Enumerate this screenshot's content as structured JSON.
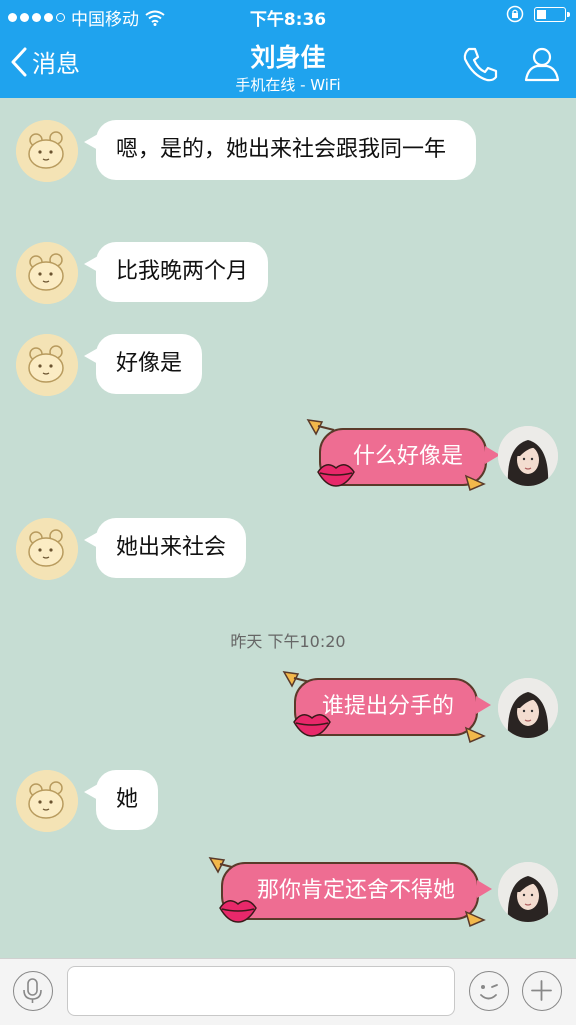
{
  "status_bar": {
    "carrier": "中国移动",
    "time": "下午8:36",
    "signal_icon": "signal-dots-icon",
    "wifi_icon": "wifi-icon",
    "lock_icon": "rotation-lock-icon",
    "battery_icon": "battery-icon"
  },
  "nav": {
    "back_label": "消息",
    "title": "刘身佳",
    "subtitle": "手机在线 - WiFi",
    "phone_icon": "phone-icon",
    "profile_icon": "person-icon"
  },
  "messages": [
    {
      "side": "in",
      "text": "嗯，是的，她出来社会跟我同一年"
    },
    {
      "side": "in",
      "text": "比我晚两个月"
    },
    {
      "side": "in",
      "text": "好像是"
    },
    {
      "side": "out",
      "text": "什么好像是"
    },
    {
      "side": "in",
      "text": "她出来社会"
    },
    {
      "side": "out",
      "text": "谁提出分手的"
    },
    {
      "side": "in",
      "text": "她"
    },
    {
      "side": "out",
      "text": "那你肯定还舍不得她"
    }
  ],
  "timestamp": "昨天  下午10:20",
  "input_bar": {
    "mic_icon": "microphone-icon",
    "input_value": "",
    "emoji_icon": "emoji-icon",
    "plus_icon": "plus-icon"
  },
  "colors": {
    "header": "#1fa3ee",
    "chat_background": "#c6ddd3",
    "incoming_bubble": "#ffffff",
    "outgoing_bubble": "#ee6d92"
  }
}
